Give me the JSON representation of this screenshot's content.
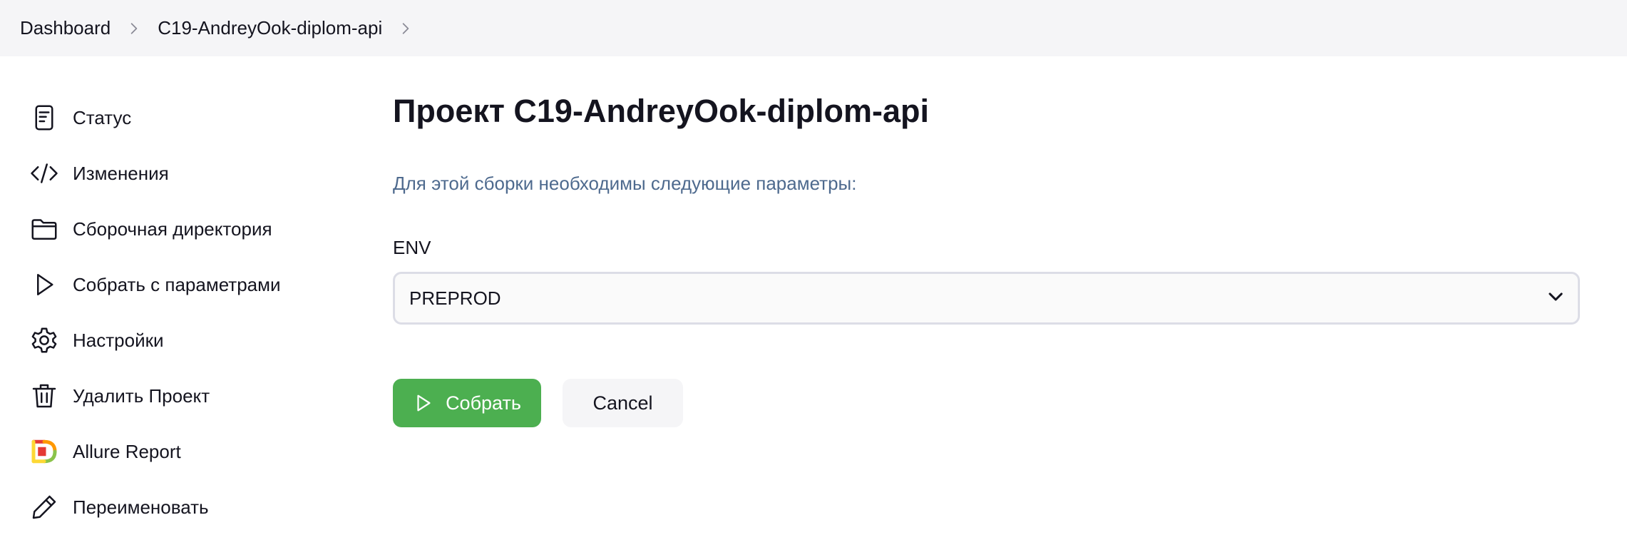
{
  "breadcrumb": {
    "items": [
      {
        "label": "Dashboard"
      },
      {
        "label": "C19-AndreyOok-diplom-api"
      }
    ]
  },
  "sidebar": {
    "items": [
      {
        "label": "Статус",
        "icon": "document-icon"
      },
      {
        "label": "Изменения",
        "icon": "code-icon"
      },
      {
        "label": "Сборочная директория",
        "icon": "folder-icon"
      },
      {
        "label": "Собрать с параметрами",
        "icon": "play-icon"
      },
      {
        "label": "Настройки",
        "icon": "gear-icon"
      },
      {
        "label": "Удалить Проект",
        "icon": "trash-icon"
      },
      {
        "label": "Allure Report",
        "icon": "allure-logo-icon"
      },
      {
        "label": "Переименовать",
        "icon": "pencil-icon"
      }
    ]
  },
  "main": {
    "title": "Проект C19-AndreyOok-diplom-api",
    "params_note": "Для этой сборки необходимы следующие параметры:",
    "param": {
      "name": "ENV",
      "value": "PREPROD"
    },
    "build_label": "Собрать",
    "cancel_label": "Cancel"
  },
  "colors": {
    "accent_green": "#4caf50",
    "note_text": "#4e6a8e",
    "breadcrumb_bg": "#f5f5f7"
  }
}
